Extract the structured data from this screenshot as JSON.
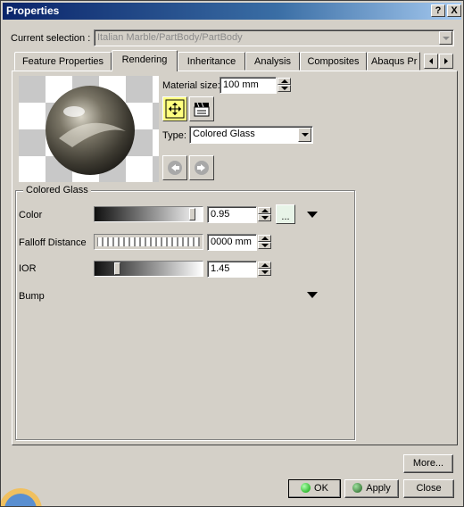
{
  "window": {
    "title": "Properties",
    "help_label": "?",
    "close_label": "X"
  },
  "selection": {
    "label": "Current selection :",
    "value": "Italian Marble/PartBody/PartBody"
  },
  "tabs": [
    {
      "label": "Feature Properties"
    },
    {
      "label": "Rendering"
    },
    {
      "label": "Inheritance"
    },
    {
      "label": "Analysis"
    },
    {
      "label": "Composites"
    },
    {
      "label": "Abaqus Pr"
    }
  ],
  "rendering": {
    "material_size_label": "Material size:",
    "material_size_value": "100 mm",
    "type_label": "Type:",
    "type_value": "Colored Glass"
  },
  "colored_glass": {
    "group_label": "Colored Glass",
    "color_label": "Color",
    "color_value": "0.95",
    "color_fraction": 0.95,
    "ellipsis_label": "...",
    "falloff_label": "Falloff Distance",
    "falloff_value": "0000 mm",
    "ior_label": "IOR",
    "ior_value": "1.45",
    "ior_fraction": 0.2,
    "bump_label": "Bump"
  },
  "buttons": {
    "more": "More...",
    "ok": "OK",
    "apply": "Apply",
    "close": "Close"
  },
  "colors": {
    "titlebar": "#0a246a",
    "ok_dot": "#00c000",
    "apply_dot": "#2e7d32",
    "face": "#d4d0c8"
  }
}
